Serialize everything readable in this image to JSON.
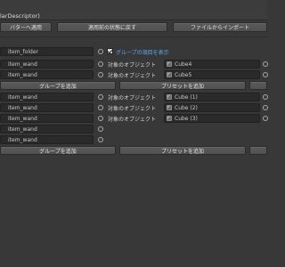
{
  "window": {
    "title": "larDescriptor)"
  },
  "toolbar": {
    "apply_to_avatar": "バターへ適用",
    "revert_state": "適用前の状態に戻す",
    "import_from_file": "ファイルからインポート"
  },
  "folder": {
    "name": "item_folder",
    "show_group_items_label": "グループの項目を表示",
    "show_group_items_checked": true
  },
  "group1": {
    "rows": [
      {
        "item": "item_wand",
        "target_label": "対象のオブジェクト",
        "object": "Cube4"
      },
      {
        "item": "item_wand",
        "target_label": "対象のオブジェクト",
        "object": "Cube5"
      }
    ],
    "add_group": "グループを追加",
    "add_preset": "プリセットを追加"
  },
  "group2": {
    "rows": [
      {
        "item": "item_wand",
        "target_label": "対象のオブジェクト",
        "object": "Cube (1)"
      },
      {
        "item": "item_wand",
        "target_label": "対象のオブジェクト",
        "object": "Cube (2)"
      },
      {
        "item": "item_wand",
        "target_label": "対象のオブジェクト",
        "object": "Cube (3)"
      },
      {
        "item": "item_wand",
        "target_label": "",
        "object": ""
      },
      {
        "item": "item_wand",
        "target_label": "",
        "object": ""
      }
    ],
    "add_group": "グループを追加",
    "add_preset": "プリセットを追加"
  },
  "colors": {
    "background": "#383838",
    "field": "#2a2a2a",
    "button": "#555555",
    "accent_text": "#5fa6e8"
  }
}
